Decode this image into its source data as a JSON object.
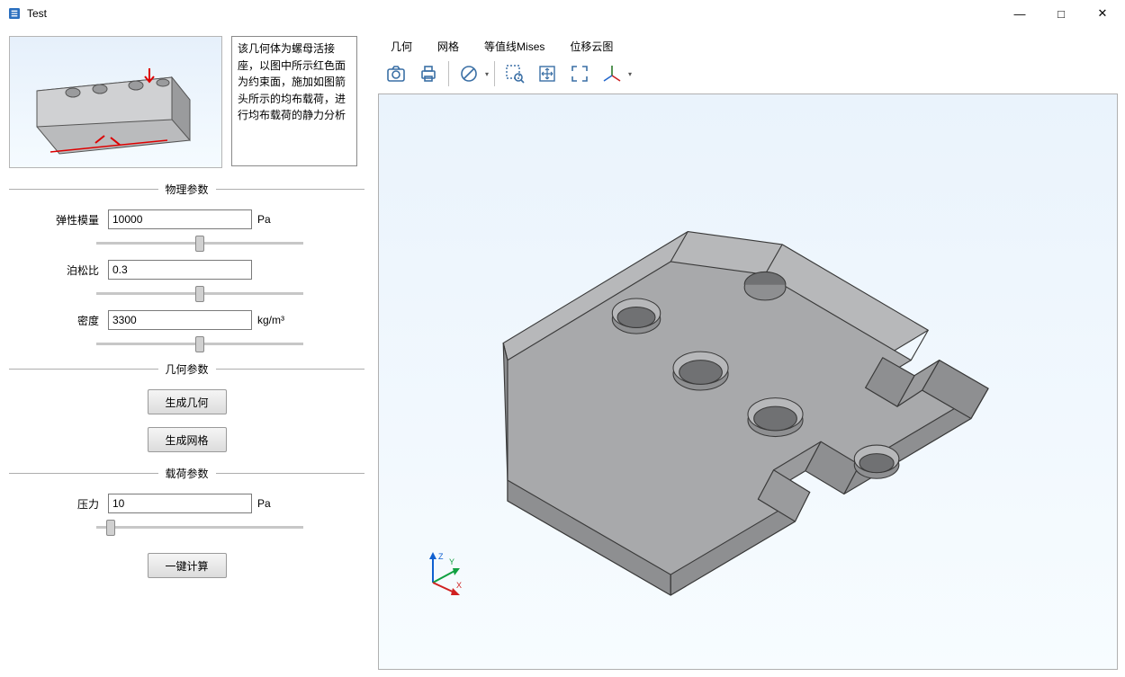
{
  "window": {
    "title": "Test"
  },
  "description": "该几何体为螺母活接座，以图中所示红色面为约束面，施加如图箭头所示的均布载荷，进行均布载荷的静力分析",
  "groups": {
    "physics": "物理参数",
    "geometry": "几何参数",
    "load": "载荷参数"
  },
  "params": {
    "youngs": {
      "label": "弹性模量",
      "value": "10000",
      "unit": "Pa",
      "slider": 50
    },
    "poisson": {
      "label": "泊松比",
      "value": "0.3",
      "unit": "",
      "slider": 50
    },
    "density": {
      "label": "密度",
      "value": "3300",
      "unit": "kg/m³",
      "slider": 50
    },
    "pressure": {
      "label": "压力",
      "value": "10",
      "unit": "Pa",
      "slider": 5
    }
  },
  "buttons": {
    "genGeom": "生成几何",
    "genMesh": "生成网格",
    "compute": "一键计算"
  },
  "tabs": [
    "几何",
    "网格",
    "等值线Mises",
    "位移云图"
  ],
  "axes": {
    "x": "X",
    "y": "Y",
    "z": "Z"
  }
}
